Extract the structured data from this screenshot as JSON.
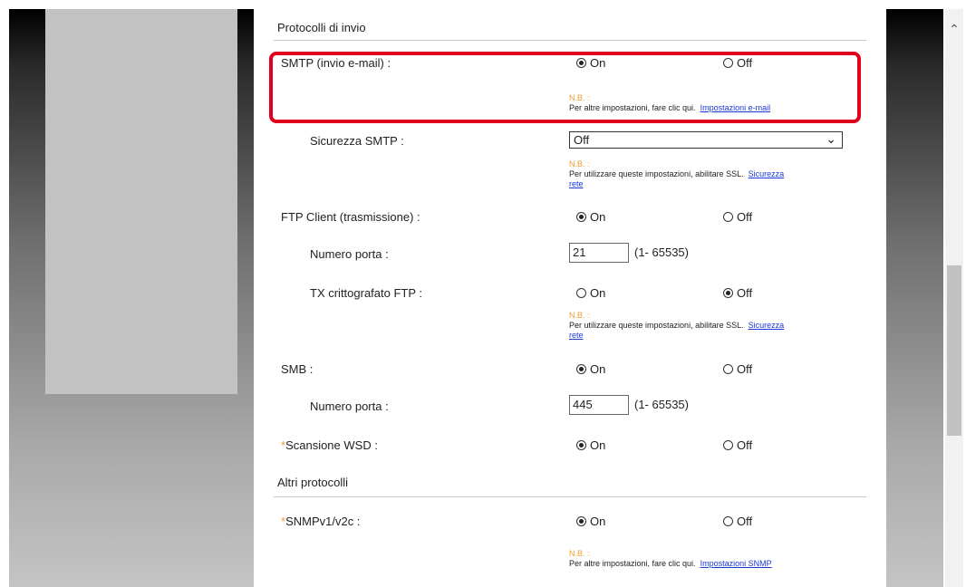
{
  "sections": {
    "send_protocols": "Protocolli di invio",
    "other_protocols": "Altri protocolli"
  },
  "smtp": {
    "label": "SMTP (invio e-mail) :",
    "on": "On",
    "off": "Off",
    "selected": "On",
    "note_title": "N.B. :",
    "note_text": "Per altre impostazioni, fare clic qui.",
    "note_link": "Impostazioni e-mail"
  },
  "smtp_security": {
    "label": "Sicurezza SMTP :",
    "value": "Off",
    "note_title": "N.B. :",
    "note_text": "Per utilizzare queste impostazioni, abilitare SSL.",
    "note_link_1": "Sicurezza",
    "note_link_2": "rete"
  },
  "ftp_client": {
    "label": "FTP Client (trasmissione) :",
    "on": "On",
    "off": "Off",
    "selected": "On"
  },
  "ftp_port": {
    "label": "Numero porta :",
    "value": "21",
    "range": "(1- 65535)"
  },
  "ftp_encrypted": {
    "label": "TX crittografato FTP :",
    "on": "On",
    "off": "Off",
    "selected": "Off",
    "note_title": "N.B. :",
    "note_text": "Per utilizzare queste impostazioni, abilitare SSL.",
    "note_link_1": "Sicurezza",
    "note_link_2": "rete"
  },
  "smb": {
    "label": "SMB :",
    "on": "On",
    "off": "Off",
    "selected": "On"
  },
  "smb_port": {
    "label": "Numero porta :",
    "value": "445",
    "range": "(1- 65535)"
  },
  "wsd_scan": {
    "asterisk": "*",
    "label": "Scansione WSD :",
    "on": "On",
    "off": "Off",
    "selected": "On"
  },
  "snmp": {
    "asterisk": "*",
    "label": "SNMPv1/v2c :",
    "on": "On",
    "off": "Off",
    "selected": "On",
    "note_title": "N.B. :",
    "note_text": "Per altre impostazioni, fare clic qui.",
    "note_link": "Impostazioni SNMP"
  },
  "icons": {
    "scroll_up": "chevron-up-icon",
    "dropdown": "chevron-down-icon"
  },
  "colors": {
    "highlight": "#e0001b",
    "note_accent": "#f39c2a",
    "link": "#1a38d4"
  }
}
